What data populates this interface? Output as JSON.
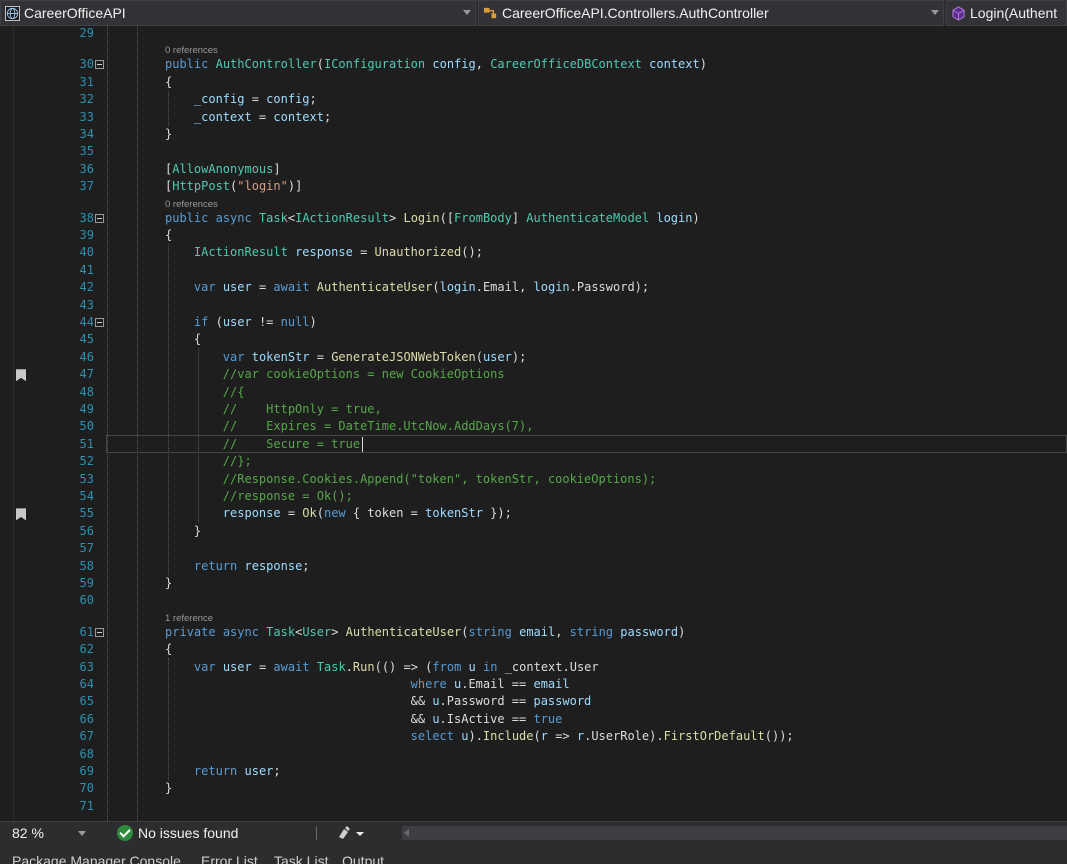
{
  "navbar": {
    "project": "CareerOfficeAPI",
    "class": "CareerOfficeAPI.Controllers.AuthController",
    "member": "Login(Authent"
  },
  "code_lines": [
    {
      "n": "29",
      "tokens": []
    },
    {
      "n": "30",
      "lens": "0 references",
      "fold": true,
      "tokens": [
        {
          "t": "public",
          "c": "kw"
        },
        {
          "t": " "
        },
        {
          "t": "AuthController",
          "c": "ty"
        },
        {
          "t": "("
        },
        {
          "t": "IConfiguration",
          "c": "ty"
        },
        {
          "t": " "
        },
        {
          "t": "config",
          "c": "id"
        },
        {
          "t": ", "
        },
        {
          "t": "CareerOfficeDBContext",
          "c": "ty"
        },
        {
          "t": " "
        },
        {
          "t": "context",
          "c": "id"
        },
        {
          "t": ")"
        }
      ]
    },
    {
      "n": "31",
      "tokens": [
        {
          "t": "{"
        }
      ]
    },
    {
      "n": "32",
      "tokens": [
        {
          "t": "    "
        },
        {
          "t": "_config",
          "c": "id"
        },
        {
          "t": " = "
        },
        {
          "t": "config",
          "c": "id"
        },
        {
          "t": ";"
        }
      ]
    },
    {
      "n": "33",
      "tokens": [
        {
          "t": "    "
        },
        {
          "t": "_context",
          "c": "id"
        },
        {
          "t": " = "
        },
        {
          "t": "context",
          "c": "id"
        },
        {
          "t": ";"
        }
      ]
    },
    {
      "n": "34",
      "tokens": [
        {
          "t": "}"
        }
      ]
    },
    {
      "n": "35",
      "tokens": []
    },
    {
      "n": "36",
      "tokens": [
        {
          "t": "["
        },
        {
          "t": "AllowAnonymous",
          "c": "at"
        },
        {
          "t": "]"
        }
      ]
    },
    {
      "n": "37",
      "tokens": [
        {
          "t": "["
        },
        {
          "t": "HttpPost",
          "c": "at"
        },
        {
          "t": "("
        },
        {
          "t": "\"login\"",
          "c": "st"
        },
        {
          "t": ")]"
        }
      ]
    },
    {
      "n": "38",
      "lens": "0 references",
      "fold": true,
      "tokens": [
        {
          "t": "public",
          "c": "kw"
        },
        {
          "t": " "
        },
        {
          "t": "async",
          "c": "kw"
        },
        {
          "t": " "
        },
        {
          "t": "Task",
          "c": "ty"
        },
        {
          "t": "<"
        },
        {
          "t": "IActionResult",
          "c": "ty"
        },
        {
          "t": "> "
        },
        {
          "t": "Login",
          "c": "mt"
        },
        {
          "t": "(["
        },
        {
          "t": "FromBody",
          "c": "at"
        },
        {
          "t": "] "
        },
        {
          "t": "AuthenticateModel",
          "c": "ty"
        },
        {
          "t": " "
        },
        {
          "t": "login",
          "c": "id"
        },
        {
          "t": ")"
        }
      ]
    },
    {
      "n": "39",
      "tokens": [
        {
          "t": "{"
        }
      ]
    },
    {
      "n": "40",
      "tokens": [
        {
          "t": "    "
        },
        {
          "t": "IActionResult",
          "c": "ty"
        },
        {
          "t": " "
        },
        {
          "t": "response",
          "c": "id"
        },
        {
          "t": " = "
        },
        {
          "t": "Unauthorized",
          "c": "mt"
        },
        {
          "t": "();"
        }
      ]
    },
    {
      "n": "41",
      "tokens": []
    },
    {
      "n": "42",
      "tokens": [
        {
          "t": "    "
        },
        {
          "t": "var",
          "c": "kw"
        },
        {
          "t": " "
        },
        {
          "t": "user",
          "c": "id"
        },
        {
          "t": " = "
        },
        {
          "t": "await",
          "c": "kw"
        },
        {
          "t": " "
        },
        {
          "t": "AuthenticateUser",
          "c": "mt"
        },
        {
          "t": "("
        },
        {
          "t": "login",
          "c": "id"
        },
        {
          "t": ".Email, "
        },
        {
          "t": "login",
          "c": "id"
        },
        {
          "t": ".Password);"
        }
      ]
    },
    {
      "n": "43",
      "tokens": []
    },
    {
      "n": "44",
      "fold": true,
      "tokens": [
        {
          "t": "    "
        },
        {
          "t": "if",
          "c": "kw"
        },
        {
          "t": " ("
        },
        {
          "t": "user",
          "c": "id"
        },
        {
          "t": " != "
        },
        {
          "t": "null",
          "c": "kw"
        },
        {
          "t": ")"
        }
      ]
    },
    {
      "n": "45",
      "tokens": [
        {
          "t": "    {"
        }
      ]
    },
    {
      "n": "46",
      "tokens": [
        {
          "t": "        "
        },
        {
          "t": "var",
          "c": "kw"
        },
        {
          "t": " "
        },
        {
          "t": "tokenStr",
          "c": "id"
        },
        {
          "t": " = "
        },
        {
          "t": "GenerateJSONWebToken",
          "c": "mt"
        },
        {
          "t": "("
        },
        {
          "t": "user",
          "c": "id"
        },
        {
          "t": ");"
        }
      ]
    },
    {
      "n": "47",
      "tokens": [
        {
          "t": "        "
        },
        {
          "t": "//var cookieOptions = new CookieOptions",
          "c": "cm"
        }
      ]
    },
    {
      "n": "48",
      "tokens": [
        {
          "t": "        "
        },
        {
          "t": "//{",
          "c": "cm"
        }
      ]
    },
    {
      "n": "49",
      "tokens": [
        {
          "t": "        "
        },
        {
          "t": "//    HttpOnly = true,",
          "c": "cm"
        }
      ]
    },
    {
      "n": "50",
      "tokens": [
        {
          "t": "        "
        },
        {
          "t": "//    Expires = DateTime.UtcNow.AddDays(7),",
          "c": "cm"
        }
      ]
    },
    {
      "n": "51",
      "tokens": [
        {
          "t": "        "
        },
        {
          "t": "//    Secure = true",
          "c": "cm"
        }
      ]
    },
    {
      "n": "52",
      "tokens": [
        {
          "t": "        "
        },
        {
          "t": "//};",
          "c": "cm"
        }
      ]
    },
    {
      "n": "53",
      "tokens": [
        {
          "t": "        "
        },
        {
          "t": "//Response.Cookies.Append(\"token\", tokenStr, cookieOptions);",
          "c": "cm"
        }
      ]
    },
    {
      "n": "54",
      "tokens": [
        {
          "t": "        "
        },
        {
          "t": "//response = Ok();",
          "c": "cm"
        }
      ]
    },
    {
      "n": "55",
      "tokens": [
        {
          "t": "        "
        },
        {
          "t": "response",
          "c": "id"
        },
        {
          "t": " = "
        },
        {
          "t": "Ok",
          "c": "mt"
        },
        {
          "t": "("
        },
        {
          "t": "new",
          "c": "kw"
        },
        {
          "t": " { token = "
        },
        {
          "t": "tokenStr",
          "c": "id"
        },
        {
          "t": " });"
        }
      ]
    },
    {
      "n": "56",
      "tokens": [
        {
          "t": "    }"
        }
      ]
    },
    {
      "n": "57",
      "tokens": []
    },
    {
      "n": "58",
      "tokens": [
        {
          "t": "    "
        },
        {
          "t": "return",
          "c": "kw"
        },
        {
          "t": " "
        },
        {
          "t": "response",
          "c": "id"
        },
        {
          "t": ";"
        }
      ]
    },
    {
      "n": "59",
      "tokens": [
        {
          "t": "}"
        }
      ]
    },
    {
      "n": "60",
      "tokens": []
    },
    {
      "n": "61",
      "lens": "1 reference",
      "fold": true,
      "tokens": [
        {
          "t": "private",
          "c": "kw"
        },
        {
          "t": " "
        },
        {
          "t": "async",
          "c": "kw"
        },
        {
          "t": " "
        },
        {
          "t": "Task",
          "c": "ty"
        },
        {
          "t": "<"
        },
        {
          "t": "User",
          "c": "ty"
        },
        {
          "t": "> "
        },
        {
          "t": "AuthenticateUser",
          "c": "mt"
        },
        {
          "t": "("
        },
        {
          "t": "string",
          "c": "kw"
        },
        {
          "t": " "
        },
        {
          "t": "email",
          "c": "id"
        },
        {
          "t": ", "
        },
        {
          "t": "string",
          "c": "kw"
        },
        {
          "t": " "
        },
        {
          "t": "password",
          "c": "id"
        },
        {
          "t": ")"
        }
      ]
    },
    {
      "n": "62",
      "tokens": [
        {
          "t": "{"
        }
      ]
    },
    {
      "n": "63",
      "tokens": [
        {
          "t": "    "
        },
        {
          "t": "var",
          "c": "kw"
        },
        {
          "t": " "
        },
        {
          "t": "user",
          "c": "id"
        },
        {
          "t": " = "
        },
        {
          "t": "await",
          "c": "kw"
        },
        {
          "t": " "
        },
        {
          "t": "Task",
          "c": "ty"
        },
        {
          "t": "."
        },
        {
          "t": "Run",
          "c": "mt"
        },
        {
          "t": "(() => ("
        },
        {
          "t": "from",
          "c": "kw"
        },
        {
          "t": " "
        },
        {
          "t": "u",
          "c": "id"
        },
        {
          "t": " "
        },
        {
          "t": "in",
          "c": "kw"
        },
        {
          "t": " _context.User"
        }
      ]
    },
    {
      "n": "64",
      "tokens": [
        {
          "t": "                                  "
        },
        {
          "t": "where",
          "c": "kw"
        },
        {
          "t": " "
        },
        {
          "t": "u",
          "c": "id"
        },
        {
          "t": ".Email == "
        },
        {
          "t": "email",
          "c": "id"
        }
      ]
    },
    {
      "n": "65",
      "tokens": [
        {
          "t": "                                  && "
        },
        {
          "t": "u",
          "c": "id"
        },
        {
          "t": ".Password == "
        },
        {
          "t": "password",
          "c": "id"
        }
      ]
    },
    {
      "n": "66",
      "tokens": [
        {
          "t": "                                  && "
        },
        {
          "t": "u",
          "c": "id"
        },
        {
          "t": ".IsActive == "
        },
        {
          "t": "true",
          "c": "kw"
        }
      ]
    },
    {
      "n": "67",
      "tokens": [
        {
          "t": "                                  "
        },
        {
          "t": "select",
          "c": "kw"
        },
        {
          "t": " "
        },
        {
          "t": "u",
          "c": "id"
        },
        {
          "t": ")."
        },
        {
          "t": "Include",
          "c": "mt"
        },
        {
          "t": "("
        },
        {
          "t": "r",
          "c": "id"
        },
        {
          "t": " => "
        },
        {
          "t": "r",
          "c": "id"
        },
        {
          "t": ".UserRole)."
        },
        {
          "t": "FirstOrDefault",
          "c": "mt"
        },
        {
          "t": "());"
        }
      ]
    },
    {
      "n": "68",
      "tokens": []
    },
    {
      "n": "69",
      "tokens": [
        {
          "t": "    "
        },
        {
          "t": "return",
          "c": "kw"
        },
        {
          "t": " "
        },
        {
          "t": "user",
          "c": "id"
        },
        {
          "t": ";"
        }
      ]
    },
    {
      "n": "70",
      "tokens": [
        {
          "t": "}"
        }
      ]
    },
    {
      "n": "71",
      "tokens": []
    }
  ],
  "status": {
    "zoom": "82 %",
    "issues": "No issues found"
  },
  "tool_tabs": [
    "Package Manager Console",
    "Error List",
    "Task List",
    "Output"
  ]
}
